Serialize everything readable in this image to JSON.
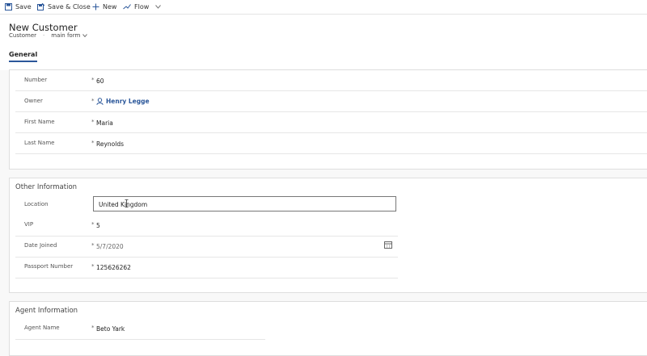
{
  "toolbar": {
    "save": "Save",
    "save_close": "Save & Close",
    "new": "New",
    "flow": "Flow"
  },
  "header": {
    "title": "New Customer",
    "entity": "Customer",
    "form": "main form"
  },
  "tabs": [
    "General"
  ],
  "general": {
    "number_label": "Number",
    "number_value": "60",
    "owner_label": "Owner",
    "owner_value": "Henry Legge",
    "first_name_label": "First Name",
    "first_name_value": "Maria",
    "last_name_label": "Last Name",
    "last_name_value": "Reynolds",
    "required_mark": "*"
  },
  "other": {
    "title": "Other Information",
    "location_label": "Location",
    "location_value": "United Kingdom",
    "vip_label": "VIP",
    "vip_value": "5",
    "date_label": "Date Joined",
    "date_value": "5/7/2020",
    "passport_label": "Passport Number",
    "passport_value": "125626262"
  },
  "agent": {
    "title": "Agent Information",
    "name_label": "Agent Name",
    "name_value": "Beto Yark"
  }
}
